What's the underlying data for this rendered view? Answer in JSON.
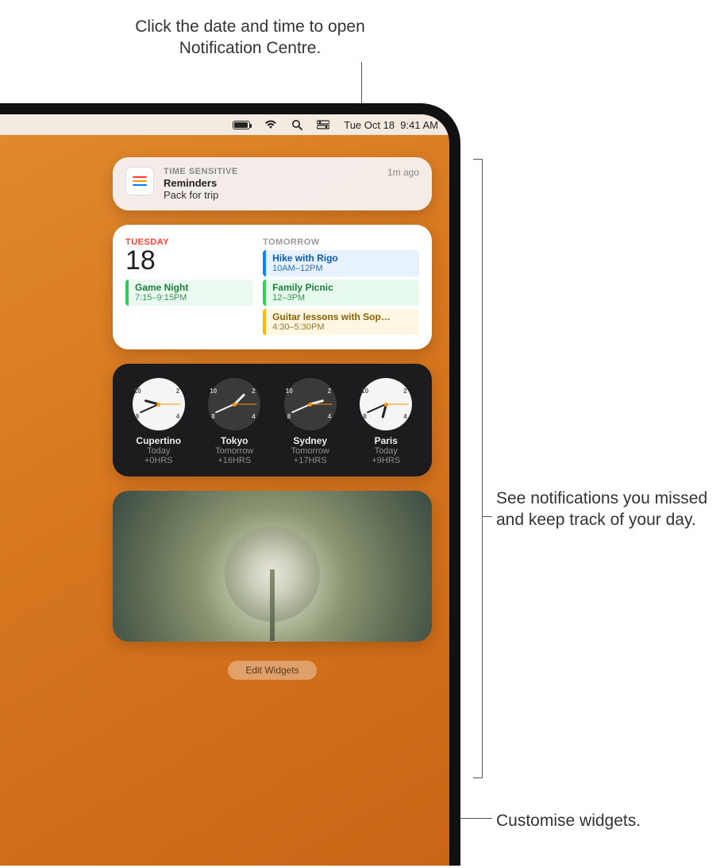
{
  "callouts": {
    "top": "Click the date and time to open Notification Centre.",
    "right": "See notifications you missed and keep track of your day.",
    "bottom": "Customise widgets."
  },
  "menubar": {
    "date": "Tue Oct 18",
    "time": "9:41 AM"
  },
  "notification": {
    "timeSensitive": "TIME SENSITIVE",
    "app": "Reminders",
    "title": "Pack for trip",
    "ago": "1m ago",
    "iconColors": [
      "#ff3b30",
      "#ff9500",
      "#007aff"
    ]
  },
  "calendar": {
    "today": {
      "dayName": "TUESDAY",
      "dayNum": "18",
      "events": [
        {
          "title": "Game Night",
          "time": "7:15–9:15PM",
          "color": "green"
        }
      ]
    },
    "tomorrowLabel": "TOMORROW",
    "tomorrow": [
      {
        "title": "Hike with Rigo",
        "time": "10AM–12PM",
        "color": "blue"
      },
      {
        "title": "Family Picnic",
        "time": "12–3PM",
        "color": "green2"
      },
      {
        "title": "Guitar lessons with Sop…",
        "time": "4:30–5:30PM",
        "color": "yellow"
      }
    ]
  },
  "clocks": [
    {
      "city": "Cupertino",
      "day": "Today",
      "offset": "+0HRS",
      "face": "light",
      "hour": 285,
      "minute": 246
    },
    {
      "city": "Tokyo",
      "day": "Tomorrow",
      "offset": "+16HRS",
      "face": "dark",
      "hour": 45,
      "minute": 246
    },
    {
      "city": "Sydney",
      "day": "Tomorrow",
      "offset": "+17HRS",
      "face": "dark",
      "hour": 75,
      "minute": 246
    },
    {
      "city": "Paris",
      "day": "Today",
      "offset": "+9HRS",
      "face": "light",
      "hour": 195,
      "minute": 246
    }
  ],
  "editWidgets": "Edit Widgets"
}
